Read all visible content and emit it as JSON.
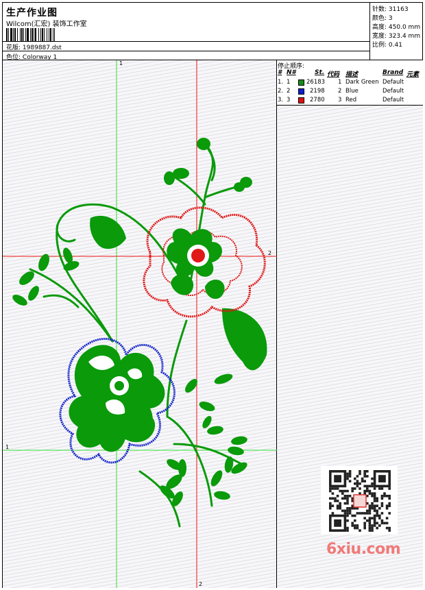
{
  "header": {
    "title": "生产作业图",
    "company": "Wilcom(汇宏) 装饰工作室",
    "design_label": "花版:",
    "design_value": "1989887.dst",
    "colorway_label": "色位:",
    "colorway_value": "Colorway 1"
  },
  "stats": {
    "stitches_label": "针数:",
    "stitches_value": "31163",
    "colors_label": "颜色:",
    "colors_value": "3",
    "height_label": "高度:",
    "height_value": "450.0 mm",
    "width_label": "宽度:",
    "width_value": "323.4 mm",
    "scale_label": "比例:",
    "scale_value": "0.41"
  },
  "stop_sequence": {
    "title": "停止顺序:",
    "columns": [
      "#",
      "N#",
      "St.",
      "代码",
      "描述",
      "Brand",
      "元素"
    ],
    "rows": [
      {
        "idx": "1.",
        "n": "1",
        "color": "#1a8a1a",
        "st": "26183",
        "code": "1",
        "desc": "Dark Green",
        "brand": "Default"
      },
      {
        "idx": "2.",
        "n": "2",
        "color": "#1020d0",
        "st": "2198",
        "code": "2",
        "desc": "Blue",
        "brand": "Default"
      },
      {
        "idx": "3.",
        "n": "3",
        "color": "#e01010",
        "st": "2780",
        "code": "3",
        "desc": "Red",
        "brand": "Default"
      }
    ]
  },
  "guides": {
    "vertical_1_label": "1",
    "horizontal_2_label": "2",
    "horizontal_1_label": "1",
    "vertical_2_label": "2"
  },
  "watermark": {
    "site": "6xiu.com"
  },
  "colors": {
    "green": "#0a9a0a",
    "blue": "#1020c8",
    "red": "#e01818",
    "guide_green": "#33dd33",
    "guide_red": "#ee1111"
  }
}
